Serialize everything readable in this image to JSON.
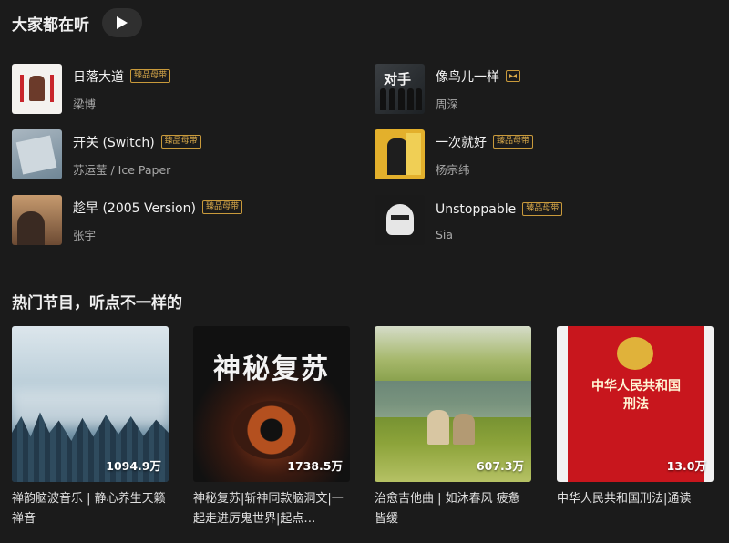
{
  "section1": {
    "title": "大家都在听"
  },
  "songs": [
    {
      "title": "日落大道",
      "artist": "梁博",
      "badge": "臻品母带",
      "badge_type": "text"
    },
    {
      "title": "像鸟儿一样",
      "artist": "周深",
      "badge": "",
      "badge_type": "icon"
    },
    {
      "title": "开关 (Switch)",
      "artist": "苏运莹 / Ice Paper",
      "badge": "臻品母带",
      "badge_type": "text"
    },
    {
      "title": "一次就好",
      "artist": "杨宗纬",
      "badge": "臻品母带",
      "badge_type": "text"
    },
    {
      "title": "趁早 (2005 Version)",
      "artist": "张宇",
      "badge": "臻品母带",
      "badge_type": "text"
    },
    {
      "title": "Unstoppable",
      "artist": "Sia",
      "badge": "臻品母带",
      "badge_type": "text"
    }
  ],
  "section2": {
    "title": "热门节目，听点不一样的"
  },
  "programs": [
    {
      "title": "禅韵脑波音乐 | 静心养生天籁禅音",
      "plays": "1094.9万"
    },
    {
      "title": "神秘复苏|斩神同款脑洞文|一起走进厉鬼世界|起点…",
      "plays": "1738.5万",
      "art_text": "神秘复苏"
    },
    {
      "title": "治愈吉他曲 | 如沐春风 疲惫皆缓",
      "plays": "607.3万"
    },
    {
      "title": "中华人民共和国刑法|通读",
      "plays": "13.0万",
      "art_text": "中华人民共和国\n刑法"
    }
  ],
  "colors": {
    "background": "#1b1b1b",
    "badge": "#d9a94a",
    "secondary_text": "#a8a8a8"
  }
}
